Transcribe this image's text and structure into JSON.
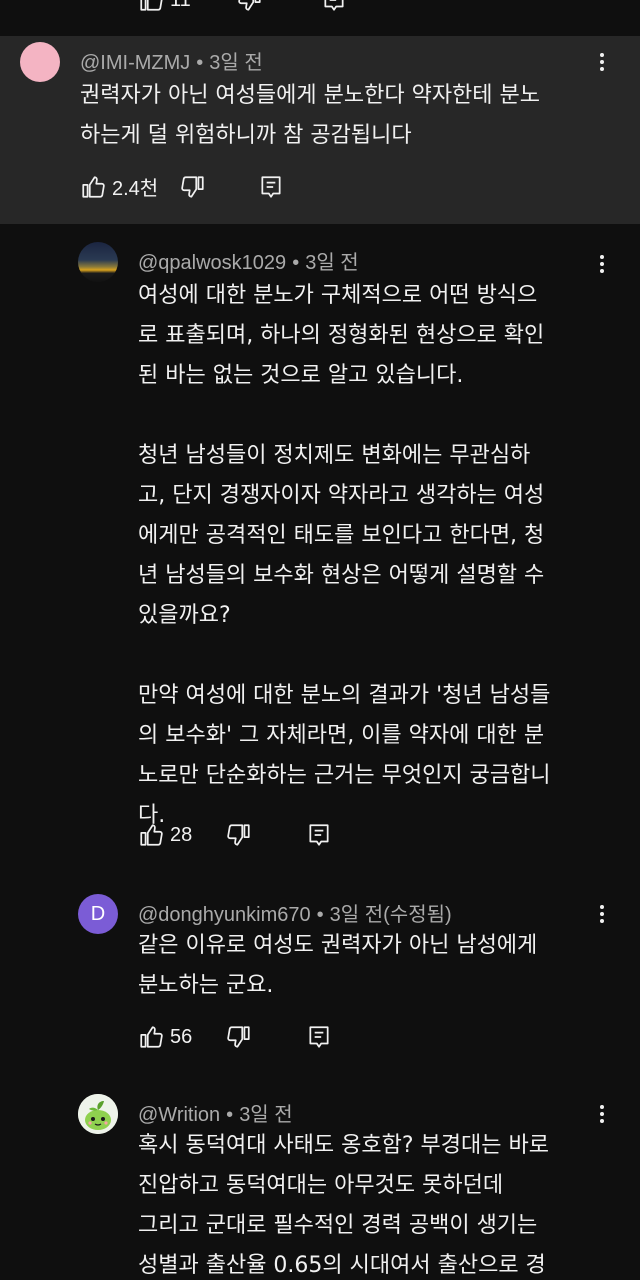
{
  "top_partial": {
    "like_count": "11"
  },
  "comments": [
    {
      "handle": "@IMI-MZMJ",
      "time": "3일 전",
      "text": "권력자가 아닌 여성들에게 분노한다 약자한테 분노\n하는게 덜 위험하니까 참 공감됩니다",
      "likes": "2.4천",
      "avatar": "pink-circle"
    },
    {
      "handle": "@qpalwosk1029",
      "time": "3일 전",
      "text": "여성에 대한 분노가 구체적으로 어떤 방식으\n로 표출되며, 하나의 정형화된 현상으로 확인\n된 바는 없는 것으로 알고 있습니다.\n\n청년 남성들이 정치제도 변화에는 무관심하\n고, 단지 경쟁자이자 약자라고 생각하는 여성\n에게만 공격적인 태도를 보인다고 한다면, 청\n년 남성들의 보수화 현상은 어떻게 설명할 수\n있을까요?\n\n만약 여성에 대한 분노의 결과가 '청년 남성들\n의 보수화' 그 자체라면, 이를 약자에 대한 분\n노로만 단순화하는 근거는 무엇인지 궁금합니\n다.",
      "likes": "28",
      "avatar": "sunset-photo"
    },
    {
      "handle": "@donghyunkim670",
      "time": "3일 전(수정됨)",
      "text": "같은 이유로 여성도 권력자가 아닌 남성에게\n분노하는 군요.",
      "likes": "56",
      "avatar_letter": "D"
    },
    {
      "handle": "@Writion",
      "time": "3일 전",
      "text": "혹시 동덕여대 사태도 옹호함? 부경대는 바로\n진압하고 동덕여대는 아무것도 못하던데\n그리고 군대로 필수적인 경력 공백이 생기는\n성별과 출산율 0.65의 시대여서 출산으로 경",
      "avatar": "green-mascot"
    }
  ],
  "icons": [
    "like-icon",
    "dislike-icon",
    "reply-icon",
    "more-vert-icon"
  ],
  "colors": {
    "background": "#0f0f0f",
    "highlight": "#272727",
    "text": "#f1f1f1",
    "meta": "#aaaaaa",
    "avatar_purple": "#7b5cd6",
    "avatar_pink": "#f4b4c3"
  }
}
